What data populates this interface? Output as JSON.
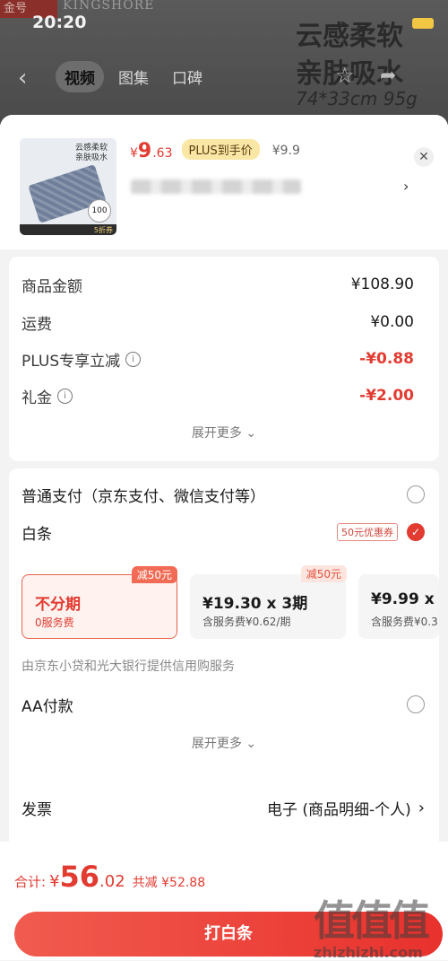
{
  "status_bar": {
    "time": "20:20"
  },
  "background": {
    "brand_tag": "金号",
    "brand_name": "KINGSHORE",
    "headline_line1": "云感柔软",
    "headline_line2": "亲肤吸水",
    "spec": "74*33cm 95g"
  },
  "header": {
    "tabs": [
      "视频",
      "图集",
      "口碑"
    ]
  },
  "product": {
    "price_symbol": "¥",
    "price_int": "9",
    "price_dec": ".63",
    "plus_tag": "PLUS到手价",
    "orig_price": "¥9.9",
    "thumb_text": "云感柔软 亲肤吸水",
    "thumb_badge": "100",
    "thumb_bar": "5折券"
  },
  "cost": {
    "rows": [
      {
        "label": "商品金额",
        "value": "¥108.90",
        "info": false,
        "red": false
      },
      {
        "label": "运费",
        "value": "¥0.00",
        "info": false,
        "red": false
      },
      {
        "label": "PLUS专享立减",
        "value": "-¥0.88",
        "info": true,
        "red": true
      },
      {
        "label": "礼金",
        "value": "-¥2.00",
        "info": true,
        "red": true
      }
    ],
    "more": "展开更多 ⌄"
  },
  "payment": {
    "normal": "普通支付（京东支付、微信支付等）",
    "baitiao": "白条",
    "coupon": "50元优惠券",
    "plans": [
      {
        "badge": "减50元",
        "title": "不分期",
        "sub": "0服务费"
      },
      {
        "badge": "减50元",
        "title": "¥19.30 x 3期",
        "sub": "含服务费¥0.62/期"
      },
      {
        "badge": "",
        "title": "¥9.99 x 6",
        "sub": "含服务费¥0.3"
      }
    ],
    "note": "由京东小贷和光大银行提供信用购服务",
    "aa": "AA付款",
    "more": "展开更多 ⌄"
  },
  "invoice": {
    "label": "发票",
    "value": "电子 (商品明细-个人)"
  },
  "footer": {
    "total_label": "合计:",
    "total_symbol": "¥",
    "total_int": "56",
    "total_dec": ".02",
    "saved": "共减 ¥52.88",
    "pay_button": "打白条"
  },
  "watermark": {
    "mark": "值值值",
    "url": "zhizhizhi.com"
  },
  "colors": {
    "accent": "#e23b31",
    "plus_tag_bg": "#fbe7a5"
  }
}
